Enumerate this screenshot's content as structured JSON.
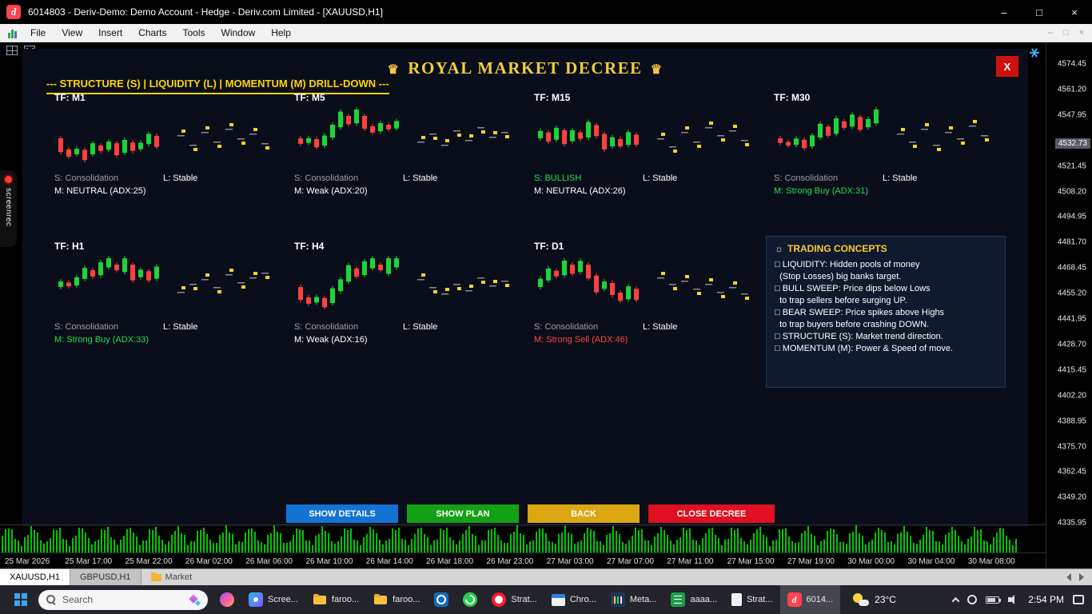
{
  "titlebar": {
    "logo": "d",
    "title": "6014803 - Deriv-Demo: Demo Account - Hedge - Deriv.com Limited - [XAUUSD,H1]",
    "minimize": "–",
    "maximize": "□",
    "close": "×"
  },
  "menu": {
    "items": [
      "File",
      "View",
      "Insert",
      "Charts",
      "Tools",
      "Window",
      "Help"
    ],
    "child_minimize": "–",
    "child_restore": "□",
    "child_close": "×"
  },
  "recorder": {
    "label": "screenrec"
  },
  "panel": {
    "crown": "♛",
    "title": "ROYAL MARKET DECREE",
    "subtitle": "--- STRUCTURE (S) | LIQUIDITY (L) | MOMENTUM (M) DRILL-DOWN ---",
    "close": "X",
    "timeframes": [
      {
        "id": "m1",
        "label": "TF: M1",
        "structure": {
          "text": "S: Consolidation",
          "color": "#9e9e9e"
        },
        "momentum": {
          "text": "M: NEUTRAL (ADX:25)",
          "color": "#ffffff"
        },
        "liquidity": {
          "text": "L: Stable",
          "color": "#ffffff"
        },
        "candles": [
          -15,
          -8,
          6,
          -11,
          12,
          -6,
          9,
          -13,
          14,
          -9,
          7,
          11,
          -12
        ],
        "levels": [
          30,
          18,
          34,
          22,
          38,
          26,
          32,
          20
        ]
      },
      {
        "id": "m5",
        "label": "TF: M5",
        "structure": {
          "text": "S: Consolidation",
          "color": "#9e9e9e"
        },
        "momentum": {
          "text": "M: Weak (ADX:20)",
          "color": "#ffffff"
        },
        "liquidity": {
          "text": "L: Stable",
          "color": "#ffffff"
        },
        "candles": [
          -6,
          5,
          -9,
          11,
          14,
          17,
          -9,
          15,
          -14,
          -7,
          9,
          -5,
          8
        ],
        "levels": [
          22,
          32,
          18,
          36,
          24,
          40,
          28,
          34
        ]
      },
      {
        "id": "m15",
        "label": "TF: M15",
        "structure": {
          "text": "S: BULLISH",
          "color": "#1fdf50"
        },
        "momentum": {
          "text": "M: NEUTRAL (ADX:26)",
          "color": "#ffffff"
        },
        "liquidity": {
          "text": "L: Stable",
          "color": "#ffffff"
        },
        "candles": [
          8,
          -10,
          13,
          -15,
          12,
          -7,
          17,
          -12,
          -17,
          10,
          -8,
          14,
          -11
        ],
        "levels": [
          26,
          16,
          34,
          22,
          40,
          30,
          36,
          24
        ]
      },
      {
        "id": "m30",
        "label": "TF: M30",
        "structure": {
          "text": "S: Consolidation",
          "color": "#9e9e9e"
        },
        "momentum": {
          "text": "M: Strong Buy (ADX:31)",
          "color": "#1fdf50"
        },
        "liquidity": {
          "text": "L: Stable",
          "color": "#ffffff"
        },
        "candles": [
          -5,
          -4,
          7,
          -9,
          12,
          15,
          -10,
          17,
          -7,
          13,
          -14,
          9,
          15
        ],
        "levels": [
          32,
          22,
          38,
          18,
          34,
          26,
          42,
          30
        ]
      },
      {
        "id": "h1",
        "label": "TF: H1",
        "structure": {
          "text": "S: Consolidation",
          "color": "#9e9e9e"
        },
        "momentum": {
          "text": "M: Strong Buy (ADX:33)",
          "color": "#1fdf50"
        },
        "liquidity": {
          "text": "L: Stable",
          "color": "#ffffff"
        },
        "candles": [
          6,
          -4,
          9,
          12,
          -7,
          14,
          10,
          -6,
          15,
          -17,
          8,
          -10,
          13
        ],
        "levels": [
          20,
          30,
          36,
          26,
          42,
          32,
          38,
          44
        ]
      },
      {
        "id": "h4",
        "label": "TF: H4",
        "structure": {
          "text": "S: Consolidation",
          "color": "#9e9e9e"
        },
        "momentum": {
          "text": "M: Weak (ADX:16)",
          "color": "#ffffff"
        },
        "liquidity": {
          "text": "L: Stable",
          "color": "#ffffff"
        },
        "candles": [
          -14,
          -7,
          6,
          -10,
          16,
          13,
          18,
          -9,
          15,
          11,
          -6,
          17,
          10
        ],
        "levels": [
          36,
          26,
          18,
          30,
          22,
          38,
          28,
          34
        ]
      },
      {
        "id": "d1",
        "label": "TF: D1",
        "structure": {
          "text": "S: Consolidation",
          "color": "#9e9e9e"
        },
        "momentum": {
          "text": "M: Strong Sell (ADX:46)",
          "color": "#ff4444"
        },
        "liquidity": {
          "text": "L: Stable",
          "color": "#ffffff"
        },
        "candles": [
          9,
          13,
          -6,
          16,
          -10,
          12,
          -15,
          -18,
          8,
          -13,
          -9,
          14,
          -12
        ],
        "levels": [
          38,
          30,
          34,
          24,
          30,
          20,
          26,
          18
        ]
      }
    ],
    "concepts": {
      "icon": "☼",
      "header": "TRADING CONCEPTS",
      "lines": [
        "□ LIQUIDITY: Hidden pools of money",
        "  (Stop Losses) big banks target.",
        "□ BULL SWEEP: Price dips below Lows",
        "  to trap sellers before surging UP.",
        "□ BEAR SWEEP: Price spikes above Highs",
        "  to trap buyers before crashing DOWN.",
        "□ STRUCTURE (S): Market trend direction.",
        "□ MOMENTUM (M): Power & Speed of move."
      ]
    },
    "buttons": [
      {
        "id": "show-details",
        "label": "SHOW DETAILS",
        "color": "#1273d4"
      },
      {
        "id": "show-plan",
        "label": "SHOW PLAN",
        "color": "#14a014"
      },
      {
        "id": "back",
        "label": "BACK",
        "color": "#dba712"
      },
      {
        "id": "close-decree",
        "label": "CLOSE DECREE",
        "color": "#e01020"
      }
    ]
  },
  "price_axis": {
    "labels": [
      "4574.45",
      "4561.20",
      "4547.95",
      "4521.45",
      "4508.20",
      "4494.95",
      "4481.70",
      "4468.45",
      "4455.20",
      "4441.95",
      "4428.70",
      "4415.45",
      "4402.20",
      "4388.95",
      "4375.70",
      "4362.45",
      "4349.20",
      "4335.95"
    ],
    "current": "4532.73"
  },
  "time_axis": {
    "labels": [
      "25 Mar 2026",
      "25 Mar 17:00",
      "25 Mar 22:00",
      "26 Mar 02:00",
      "26 Mar 06:00",
      "26 Mar 10:00",
      "26 Mar 14:00",
      "26 Mar 18:00",
      "26 Mar 23:00",
      "27 Mar 03:00",
      "27 Mar 07:00",
      "27 Mar 11:00",
      "27 Mar 15:00",
      "27 Mar 19:00",
      "30 Mar 00:00",
      "30 Mar 04:00",
      "30 Mar 08:00"
    ]
  },
  "tabs": {
    "active": "XAUUSD,H1",
    "second": "GBPUSD,H1",
    "market": "Market"
  },
  "taskbar": {
    "search": "Search",
    "items": [
      {
        "icon": "copilot",
        "label": ""
      },
      {
        "icon": "screenrec",
        "label": "Scree..."
      },
      {
        "icon": "folder",
        "label": "faroo..."
      },
      {
        "icon": "folder",
        "label": "faroo..."
      },
      {
        "icon": "outlook",
        "label": ""
      },
      {
        "icon": "whatsapp",
        "label": ""
      },
      {
        "icon": "opera",
        "label": "Strat..."
      },
      {
        "icon": "window",
        "label": "Chro..."
      },
      {
        "icon": "metatrader",
        "label": "Meta..."
      },
      {
        "icon": "sheet",
        "label": "aaaa..."
      },
      {
        "icon": "document",
        "label": "Strat..."
      },
      {
        "icon": "deriv",
        "glyph": "d",
        "label": "6014...",
        "active": true
      }
    ],
    "weather": "23°C",
    "time": "2:54 PM"
  }
}
